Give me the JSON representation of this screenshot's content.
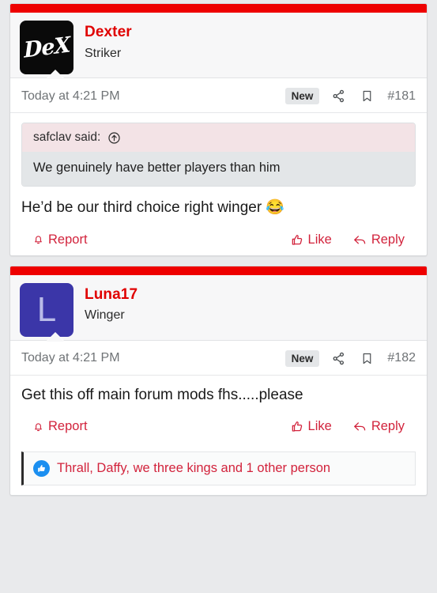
{
  "theme": {
    "accent_red": "#ee0000",
    "link_red": "#d2233c",
    "username_red": "#e00000",
    "page_bg": "#e9eaec",
    "card_bg": "#ffffff",
    "header_bg": "#f7f7f8",
    "quote_head_bg": "#f3e3e6",
    "quote_body_bg": "#e3e6e8",
    "badge_bg": "#e4e6e8",
    "reaction_blue": "#1b8ff0"
  },
  "posts": [
    {
      "avatar": {
        "type": "image-logo",
        "text": "DeX",
        "bg": "#0a0a0a",
        "fg": "#ffffff"
      },
      "username": "Dexter",
      "usertitle": "Striker",
      "meta": {
        "date": "Today at 4:21 PM",
        "badge": "New",
        "share_icon": "share-icon",
        "bookmark_icon": "bookmark-icon",
        "number": "#181"
      },
      "quote": {
        "attribution": "safclav said:",
        "jump_icon": "jump-to-quote-icon",
        "text": "We genuinely have better players than him"
      },
      "message": "He’d be our third choice right winger",
      "emoji": "😂",
      "actions": {
        "report": "Report",
        "like": "Like",
        "reply": "Reply"
      },
      "reactions": null
    },
    {
      "avatar": {
        "type": "letter",
        "text": "L",
        "bg": "#3b36a8",
        "fg": "#b9bbe8"
      },
      "username": "Luna17",
      "usertitle": "Winger",
      "meta": {
        "date": "Today at 4:21 PM",
        "badge": "New",
        "share_icon": "share-icon",
        "bookmark_icon": "bookmark-icon",
        "number": "#182"
      },
      "quote": null,
      "message": "Get this off main forum mods fhs.....please",
      "emoji": "",
      "actions": {
        "report": "Report",
        "like": "Like",
        "reply": "Reply"
      },
      "reactions": {
        "icon": "thumbs-up-reaction-icon",
        "text": "Thrall, Daffy, we three kings and 1 other person"
      }
    }
  ]
}
